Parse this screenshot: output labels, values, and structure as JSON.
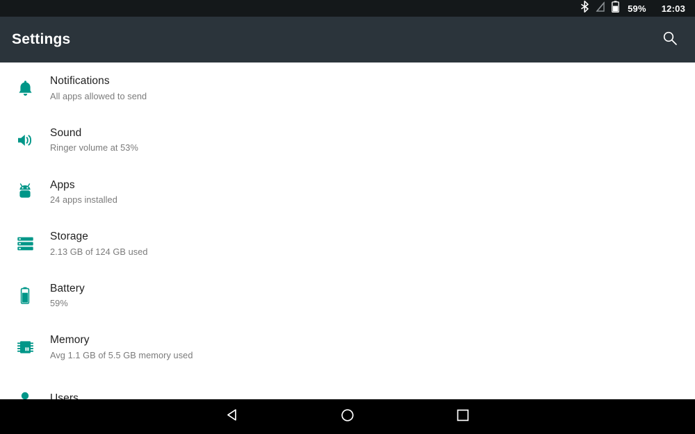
{
  "statusbar": {
    "icons": [
      "bluetooth-icon",
      "signal-off-icon",
      "battery-icon"
    ],
    "battery_percent": "59%",
    "clock": "12:03",
    "background": "#14181a"
  },
  "appbar": {
    "title": "Settings",
    "search_icon": "search-icon",
    "background": "#2b343b",
    "title_color": "#ffffff"
  },
  "theme": {
    "accent": "#009688",
    "title_color": "#1f1f1f",
    "subtitle_color": "#7b7b7b",
    "page_background": "#ffffff"
  },
  "settings_list": {
    "items": [
      {
        "icon": "bell-icon",
        "title": "Notifications",
        "subtitle": "All apps allowed to send"
      },
      {
        "icon": "volume-up-icon",
        "title": "Sound",
        "subtitle": "Ringer volume at 53%"
      },
      {
        "icon": "android-robot-icon",
        "title": "Apps",
        "subtitle": "24 apps installed"
      },
      {
        "icon": "storage-icon",
        "title": "Storage",
        "subtitle": "2.13 GB of 124 GB used"
      },
      {
        "icon": "battery-icon",
        "title": "Battery",
        "subtitle": "59%"
      },
      {
        "icon": "memory-chip-icon",
        "title": "Memory",
        "subtitle": "Avg 1.1 GB of 5.5 GB memory used"
      },
      {
        "icon": "user-icon",
        "title": "Users",
        "subtitle": ""
      }
    ]
  },
  "navbar": {
    "back_label": "back-icon",
    "home_label": "home-icon",
    "recents_label": "recents-icon",
    "background": "#000000"
  }
}
